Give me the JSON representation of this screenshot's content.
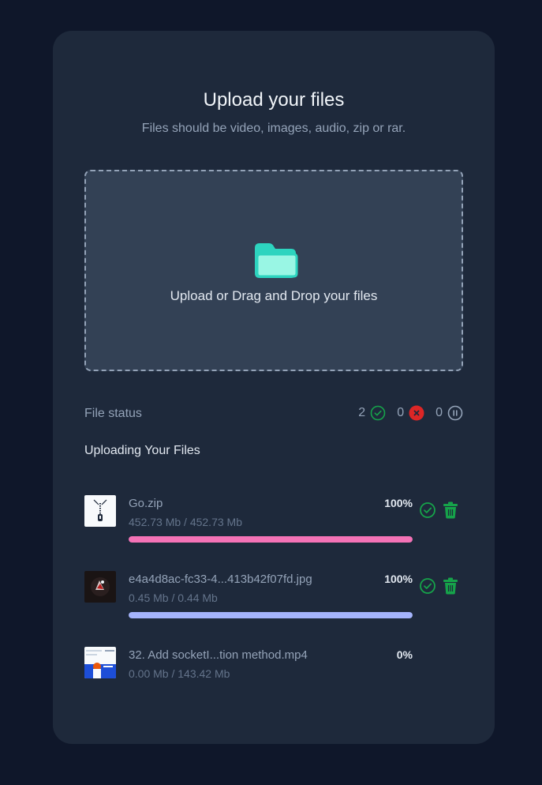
{
  "header": {
    "title": "Upload your files",
    "subtitle": "Files should be video, images, audio, zip or rar."
  },
  "dropzone": {
    "label": "Upload or Drag and Drop your files",
    "icon": "folder-open-icon",
    "icon_color": "#2dd4bf"
  },
  "status": {
    "label": "File status",
    "completed": "2",
    "failed": "0",
    "paused": "0",
    "colors": {
      "completed": "#16a34a",
      "failed": "#dc2626",
      "paused": "#94a3b8"
    }
  },
  "uploads": {
    "title": "Uploading Your Files",
    "files": [
      {
        "name": "Go.zip",
        "size": "452.73 Mb / 452.73 Mb",
        "percent": "100%",
        "progress": 1.0,
        "bar_color": "#f472b6",
        "thumb": "zip-file-icon"
      },
      {
        "name": "e4a4d8ac-fc33-4...413b42f07fd.jpg",
        "size": "0.45 Mb / 0.44 Mb",
        "percent": "100%",
        "progress": 1.0,
        "bar_color": "#a5b4fc",
        "thumb": "image-thumbnail"
      },
      {
        "name": "32. Add socketI...tion method.mp4",
        "size": "0.00 Mb / 143.42 Mb",
        "percent": "0%",
        "progress": 0.0,
        "thumb": "video-thumbnail"
      }
    ]
  }
}
